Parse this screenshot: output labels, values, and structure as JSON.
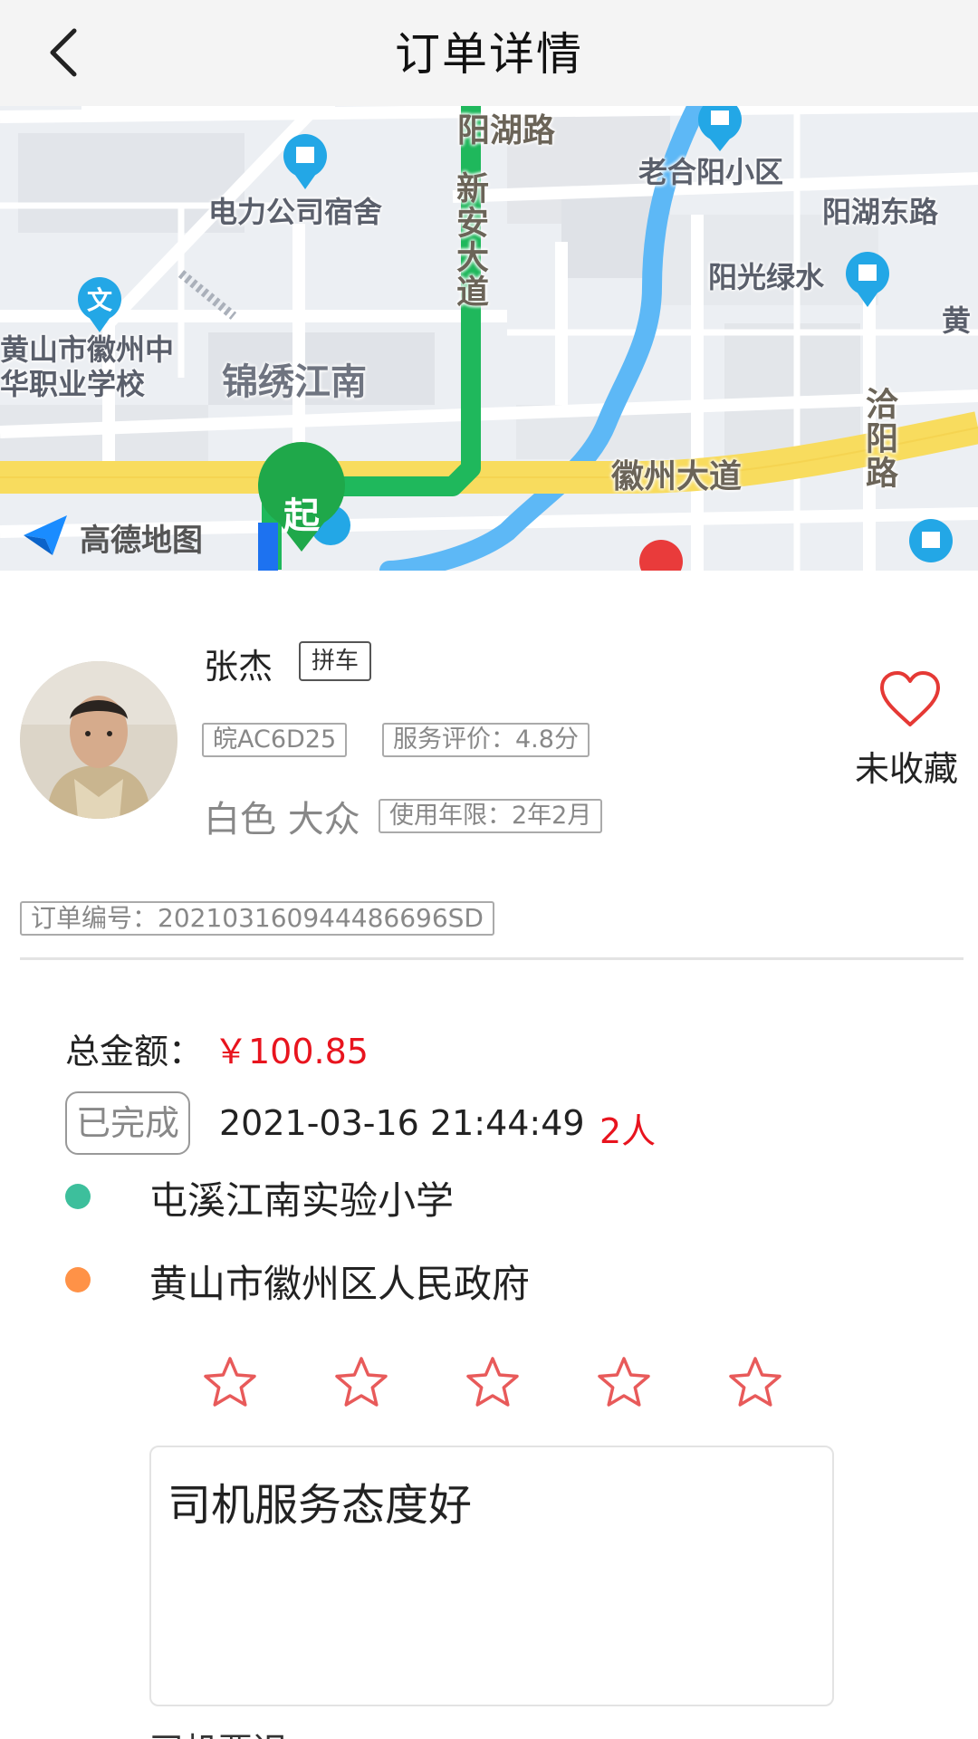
{
  "header": {
    "title": "订单详情",
    "back_icon": "chevron-left-icon"
  },
  "map": {
    "provider_logo": "高德地图",
    "start_marker": "起",
    "labels": {
      "yanghu_road": "阳湖路",
      "old_heyang": "老合阳小区",
      "power_dorm": "电力公司宿舍",
      "yanghu_east": "阳湖东路",
      "xinan_ave": "新安大道",
      "sunshine": "阳光绿水",
      "school": "黄山市徽州中华职业学校",
      "jinxiu": "锦绣江南",
      "huang": "黄",
      "luoyang": "洽阳路",
      "huizhou_ave": "徽州大道"
    }
  },
  "driver": {
    "name": "张杰",
    "ride_type": "拼车",
    "plate": "皖AC6D25",
    "rating": "服务评价：4.8分",
    "car": "白色 大众",
    "years": "使用年限：2年2月",
    "favorite_label": "未收藏"
  },
  "order": {
    "number": "订单编号：202103160944486696SD",
    "total_label": "总金额：",
    "total_value": "￥100.85",
    "status": "已完成",
    "time": "2021-03-16 21:44:49",
    "passengers": "2人",
    "origin": "屯溪江南实验小学",
    "destination": "黄山市徽州区人民政府"
  },
  "rating": {
    "stars": 5,
    "filled": 0,
    "star_color": "#e85a5a"
  },
  "comment": {
    "text": "司机服务态度好"
  },
  "footer": {
    "partial_text": "司机要迟"
  },
  "colors": {
    "accent_red": "#e8141e",
    "origin_dot": "#3dbf9c",
    "destination_dot": "#ff9247",
    "route_green": "#1fb85c",
    "river_blue": "#5db8f6",
    "main_road_yellow": "#f8dc5e"
  }
}
